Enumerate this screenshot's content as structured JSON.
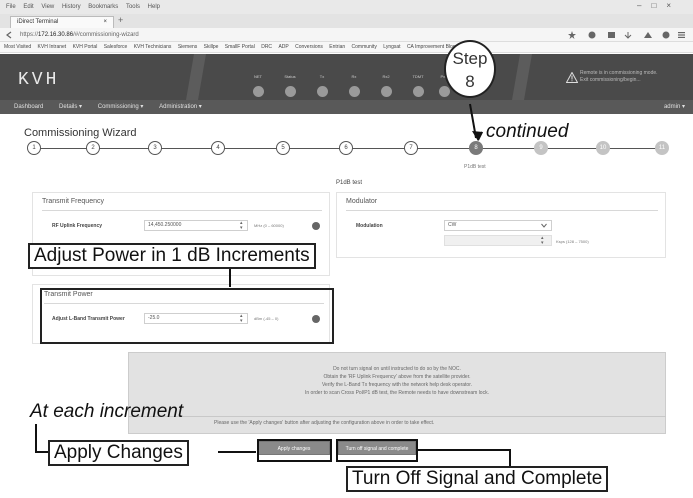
{
  "browser": {
    "menu": [
      "File",
      "Edit",
      "View",
      "History",
      "Bookmarks",
      "Tools",
      "Help"
    ],
    "tab_title": "iDirect Terminal",
    "tab_close": "×",
    "new_tab": "+",
    "url_prefix": "https://",
    "url_host": "172.16.30.86",
    "url_path": "/#/commissioning-wizard",
    "bookmarks": [
      "Most Visited",
      "KVH Intranet",
      "KVH Portal",
      "Salesforce",
      "KVH Technicians",
      "Siemens",
      "Skillpe",
      "SmallF Portal",
      "DRC",
      "ADP",
      "Conversions",
      "Entrian",
      "Community",
      "Lyngsat",
      "CA Improvement Blog"
    ],
    "window_controls": [
      "–",
      "□",
      "×"
    ]
  },
  "app": {
    "logo": "KVH",
    "indicators": [
      {
        "label": "NET"
      },
      {
        "label": "Status"
      },
      {
        "label": "Tx"
      },
      {
        "label": "Rx"
      },
      {
        "label": "Rx2"
      },
      {
        "label": "TDMT"
      },
      {
        "label": "Pwr"
      }
    ],
    "warning_line1": "Remote is in commissioning mode.",
    "warning_line2": "Exit commissioning/begin...",
    "nav": [
      "Dashboard",
      "Details ▾",
      "Commissioning ▾",
      "Administration ▾"
    ],
    "user": "admin ▾"
  },
  "wizard": {
    "title": "Commissioning Wizard",
    "steps": [
      "1",
      "2",
      "3",
      "4",
      "5",
      "6",
      "7",
      "8",
      "9",
      "10",
      "11"
    ],
    "active_step": 8,
    "active_step_label": "P1dB test",
    "section_title": "P1dB test",
    "transmit_frequency": {
      "title": "Transmit Frequency",
      "label": "RF Uplink Frequency",
      "value": "14,450.250000",
      "unit": "MHz (0 – 60000)"
    },
    "modulator": {
      "title": "Modulator",
      "label": "Modulation",
      "value": "CW",
      "unit": "Ksps (128 – 7500)"
    },
    "transmit_power": {
      "title": "Transmit Power",
      "label": "Adjust L-Band Transmit Power",
      "value": "-25.0",
      "unit": "dBm (-45 – 0)"
    },
    "notice_lines": [
      "Do not turn signal on until instructed to do so by the NOC.",
      "Obtain the 'RF Uplink Frequency' above from the satellite provider.",
      "Verify the L-Band Tx frequency with the network help desk operator.",
      "In order to scan Cross Pol/P1 dB test, the Remote needs to have downstream lock."
    ],
    "apply_hint": "Please use the 'Apply changes' button after adjusting the configuration above in order to take effect.",
    "apply_button": "Apply changes",
    "complete_button": "Turn off signal and complete"
  },
  "callouts": {
    "step_word": "Step",
    "step_number": "8",
    "continued": "continued",
    "adjust_power": "Adjust Power in 1 dB Increments",
    "at_each_increment": "At each increment",
    "apply_changes": "Apply Changes",
    "turn_off": "Turn Off Signal and Complete"
  },
  "colors": {
    "header_bg": "#4a4a4a",
    "nav_bg": "#595959",
    "active_step": "#7a7a7a",
    "button_bg": "#8a8a8a"
  }
}
